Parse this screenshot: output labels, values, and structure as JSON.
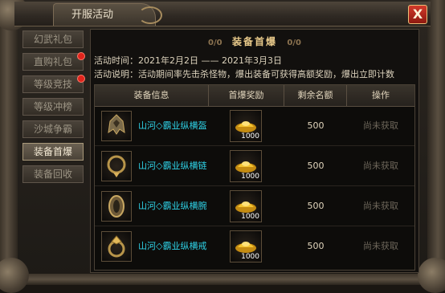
{
  "window": {
    "title": "开服活动",
    "close_label": "X"
  },
  "sidebar": {
    "items": [
      {
        "label": "幻武礼包",
        "badge": false,
        "active": false
      },
      {
        "label": "直购礼包",
        "badge": true,
        "active": false
      },
      {
        "label": "等级竞技",
        "badge": true,
        "active": false
      },
      {
        "label": "等级冲榜",
        "badge": false,
        "active": false
      },
      {
        "label": "沙城争霸",
        "badge": false,
        "active": false
      },
      {
        "label": "装备首爆",
        "badge": false,
        "active": true
      },
      {
        "label": "装备回收",
        "badge": false,
        "active": false
      }
    ]
  },
  "main": {
    "heading": "装备首爆",
    "heading_ornament": "0/0",
    "activity_time_label": "活动时间：",
    "activity_time_value": "2021年2月2日 —— 2021年3月3日",
    "activity_desc_label": "活动说明：",
    "activity_desc_value": "活动期间率先击杀怪物，爆出装备可获得高额奖励，爆出立即计数",
    "columns": [
      "装备信息",
      "首爆奖励",
      "剩余名额",
      "操作"
    ],
    "rows": [
      {
        "name": "山河◇霸业纵横盔",
        "icon": "helmet-icon",
        "reward_icon": "gold-ingot-icon",
        "reward_count": "1000",
        "remaining": "500",
        "status": "尚未获取"
      },
      {
        "name": "山河◇霸业纵横链",
        "icon": "necklace-icon",
        "reward_icon": "gold-ingot-icon",
        "reward_count": "1000",
        "remaining": "500",
        "status": "尚未获取"
      },
      {
        "name": "山河◇霸业纵横腕",
        "icon": "bracelet-icon",
        "reward_icon": "gold-ingot-icon",
        "reward_count": "1000",
        "remaining": "500",
        "status": "尚未获取"
      },
      {
        "name": "山河◇霸业纵横戒",
        "icon": "ring-icon",
        "reward_icon": "gold-ingot-icon",
        "reward_count": "1000",
        "remaining": "500",
        "status": "尚未获取"
      }
    ]
  },
  "colors": {
    "item_name": "#2fd3e8",
    "heading": "#e8c98a",
    "close_button": "#d23a2a",
    "badge": "#e0241c"
  }
}
